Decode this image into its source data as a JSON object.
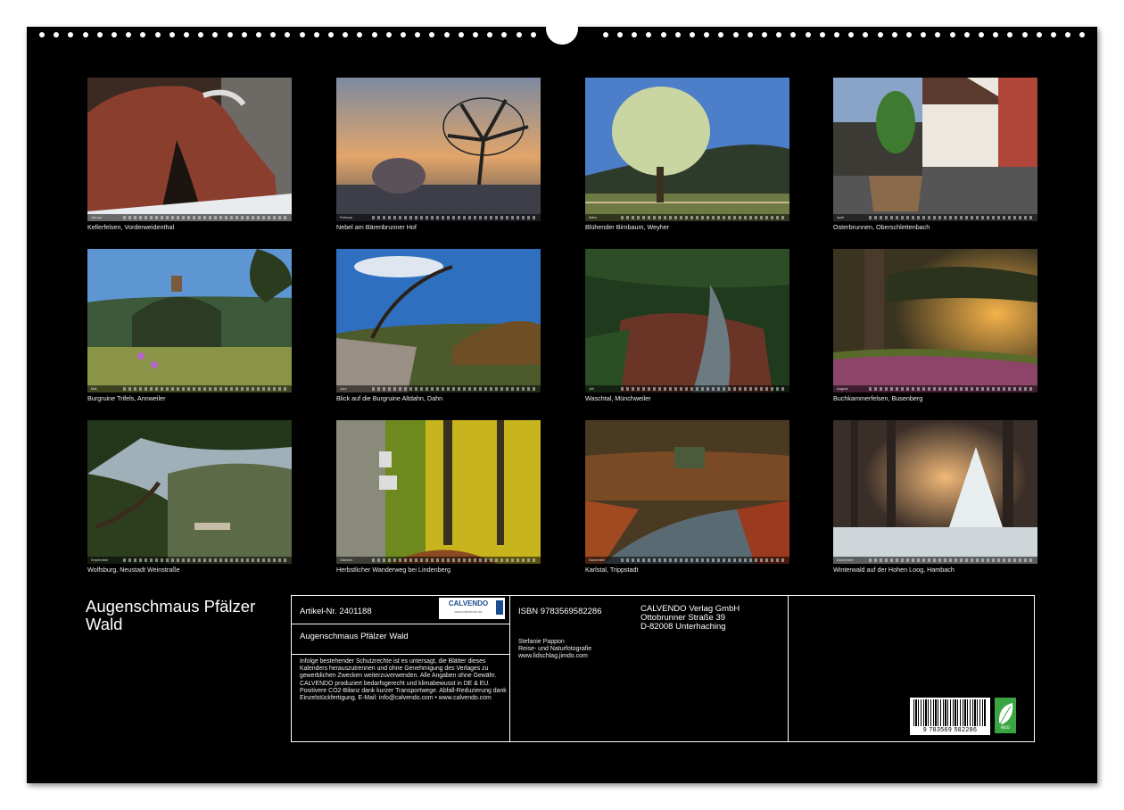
{
  "calendar": {
    "title": "Augenschmaus Pfälzer Wald",
    "months": [
      {
        "month": "Januar",
        "caption": "Kellerfelsen, Vorderweidenthal"
      },
      {
        "month": "Februar",
        "caption": "Nebel am Bärenbrunner Hof"
      },
      {
        "month": "März",
        "caption": "Blühender Birnbaum, Weyher"
      },
      {
        "month": "April",
        "caption": "Osterbrunnen, Oberschlettenbach"
      },
      {
        "month": "Mai",
        "caption": "Burgruine Trifels, Annweiler"
      },
      {
        "month": "Juni",
        "caption": "Blick auf die Burgruine Altdahn, Dahn"
      },
      {
        "month": "Juli",
        "caption": "Waschtal, Münchweiler"
      },
      {
        "month": "August",
        "caption": "Buchkammerfelsen, Busenberg"
      },
      {
        "month": "September",
        "caption": "Wolfsburg, Neustadt Weinstraße"
      },
      {
        "month": "Oktober",
        "caption": "Herbstlicher Wanderweg bei Lindenberg"
      },
      {
        "month": "November",
        "caption": "Karlstal, Trippstadt"
      },
      {
        "month": "Dezember",
        "caption": "Winterwald auf der Hohen Loog, Hambach"
      }
    ]
  },
  "info": {
    "artikel": "Artikel-Nr. 2401188",
    "logo_text": "CALVENDO",
    "logo_subtext": "www.calvendo.de",
    "product_title": "Augenschmaus Pfälzer Wald",
    "legal_text": "Infolge bestehender Schutzrechte ist es untersagt, die Blätter dieses Kalenders herauszutrennen und ohne Genehmigung des Verlages zu gewerblichen Zwecken weiterzuverwenden. Alle Angaben ohne Gewähr. CALVENDO produziert bedarfsgerecht und klimabewusst in DE & EU. Positivere CO2-Bilanz dank kurzer Transportwege. Abfall-Reduzierung dank Einzelstückfertigung. E-Mail: info@calvendo.com • www.calvendo.com",
    "isbn": "ISBN 9783569582286",
    "publisher_lines": [
      "CALVENDO Verlag GmbH",
      "Ottobrunner Straße 39",
      "D-82008 Unterhaching"
    ],
    "author_lines": [
      "Stefanie Pappon",
      "Reise- und Naturfotografie",
      "www.lidschlag.jimdo.com"
    ],
    "barcode_number": "9 783569 582286",
    "eco_label": "eco"
  }
}
